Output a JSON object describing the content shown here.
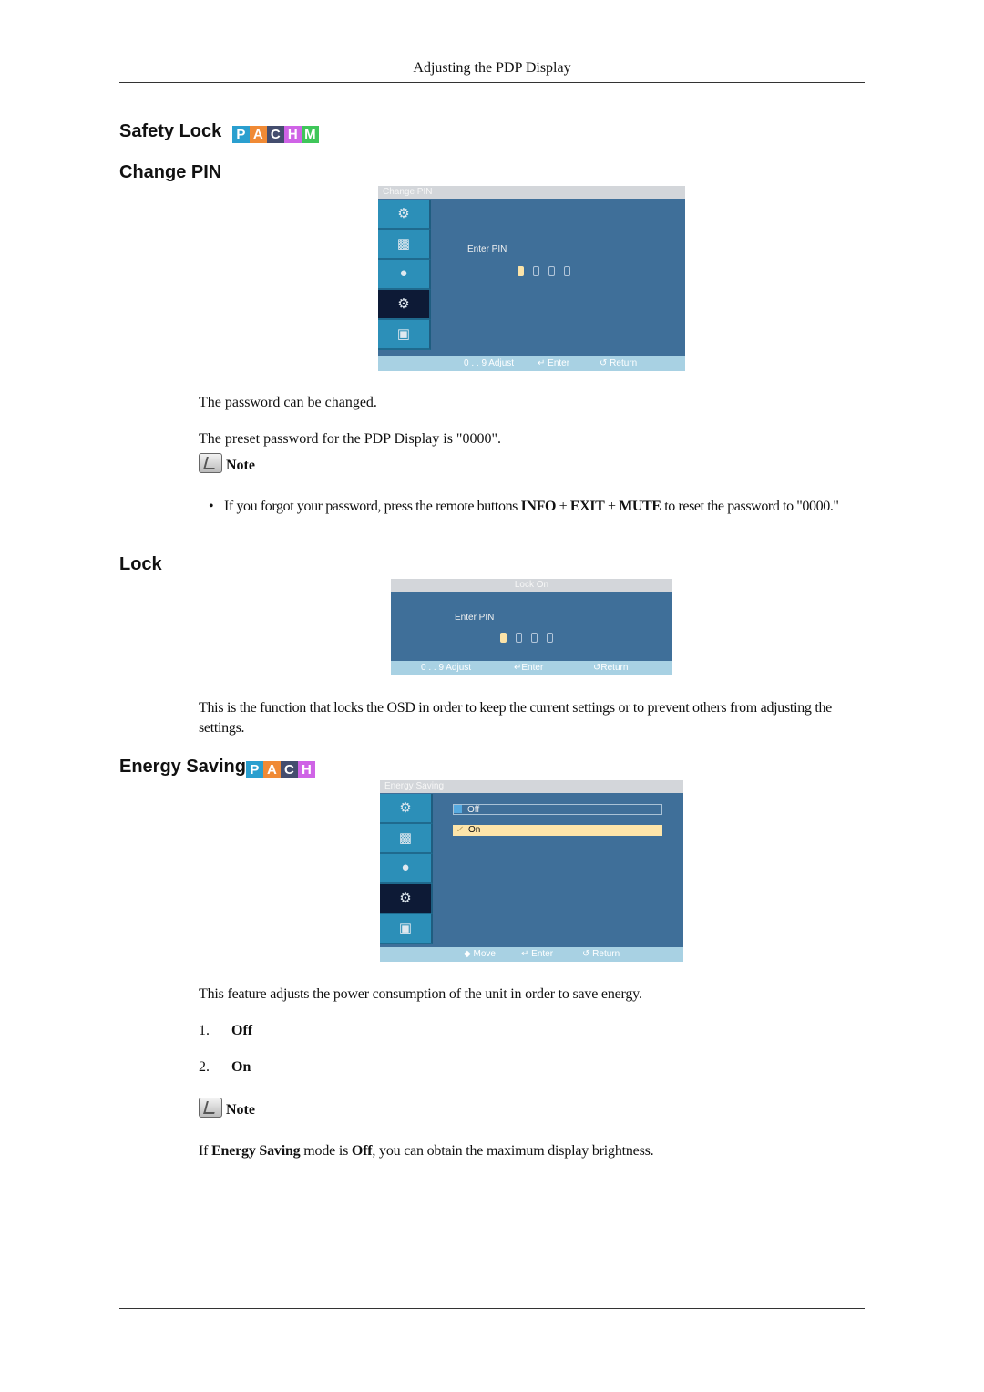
{
  "header": {
    "running_title": "Adjusting the PDP Display"
  },
  "mode_colors": {
    "P": "#2a9fcf",
    "A": "#f08a35",
    "C": "#444d6e",
    "H": "#cf63e6",
    "M": "#3fc65a"
  },
  "safety_lock": {
    "heading": "Safety Lock",
    "modes": [
      "P",
      "A",
      "C",
      "H",
      "M"
    ]
  },
  "change_pin": {
    "heading": "Change PIN",
    "osd": {
      "title": "Change PIN",
      "sidebar": [
        "picture-icon",
        "sound-icon",
        "setup-icon",
        "settings-gear-icon",
        "multi-control-icon"
      ],
      "active_index": 3,
      "label": "Enter PIN",
      "pin_digits": 4,
      "footer": {
        "adjust": "0 . . 9  Adjust",
        "enter": "Enter",
        "return": "Return"
      }
    },
    "paragraphs": [
      "The password can be changed.",
      "The preset password for the PDP Display is \"0000\"."
    ],
    "note_label": "Note",
    "note_bullet": {
      "pre": "If you forgot your password, press the remote buttons ",
      "b1": "INFO",
      "plus1": " + ",
      "b2": "EXIT",
      "plus2": " + ",
      "b3": "MUTE",
      "post": " to reset the password to \"0000.\""
    }
  },
  "lock": {
    "heading": "Lock",
    "osd": {
      "title": "Lock On",
      "label": "Enter PIN",
      "pin_digits": 4,
      "footer": {
        "adjust": "0 . . 9  Adjust",
        "enter": "Enter",
        "return": "Return"
      }
    },
    "paragraph": "This is the function that locks the OSD in order to keep the current settings or to prevent others from adjusting the settings."
  },
  "energy_saving": {
    "heading": "Energy Saving",
    "modes": [
      "P",
      "A",
      "C",
      "H"
    ],
    "osd": {
      "title": "Energy Saving",
      "options": [
        "Off",
        "On"
      ],
      "selected": "On",
      "footer": {
        "move": "Move",
        "enter": "Enter",
        "return": "Return"
      }
    },
    "paragraph": "This feature adjusts the power consumption of the unit in order to save energy.",
    "list": [
      {
        "num": "1.",
        "label": "Off"
      },
      {
        "num": "2.",
        "label": "On"
      }
    ],
    "note_label": "Note",
    "note_text": {
      "pre": "If ",
      "b1": "Energy Saving",
      "mid": " mode is ",
      "b2": "Off",
      "post": ", you can obtain the maximum display brightness."
    }
  }
}
